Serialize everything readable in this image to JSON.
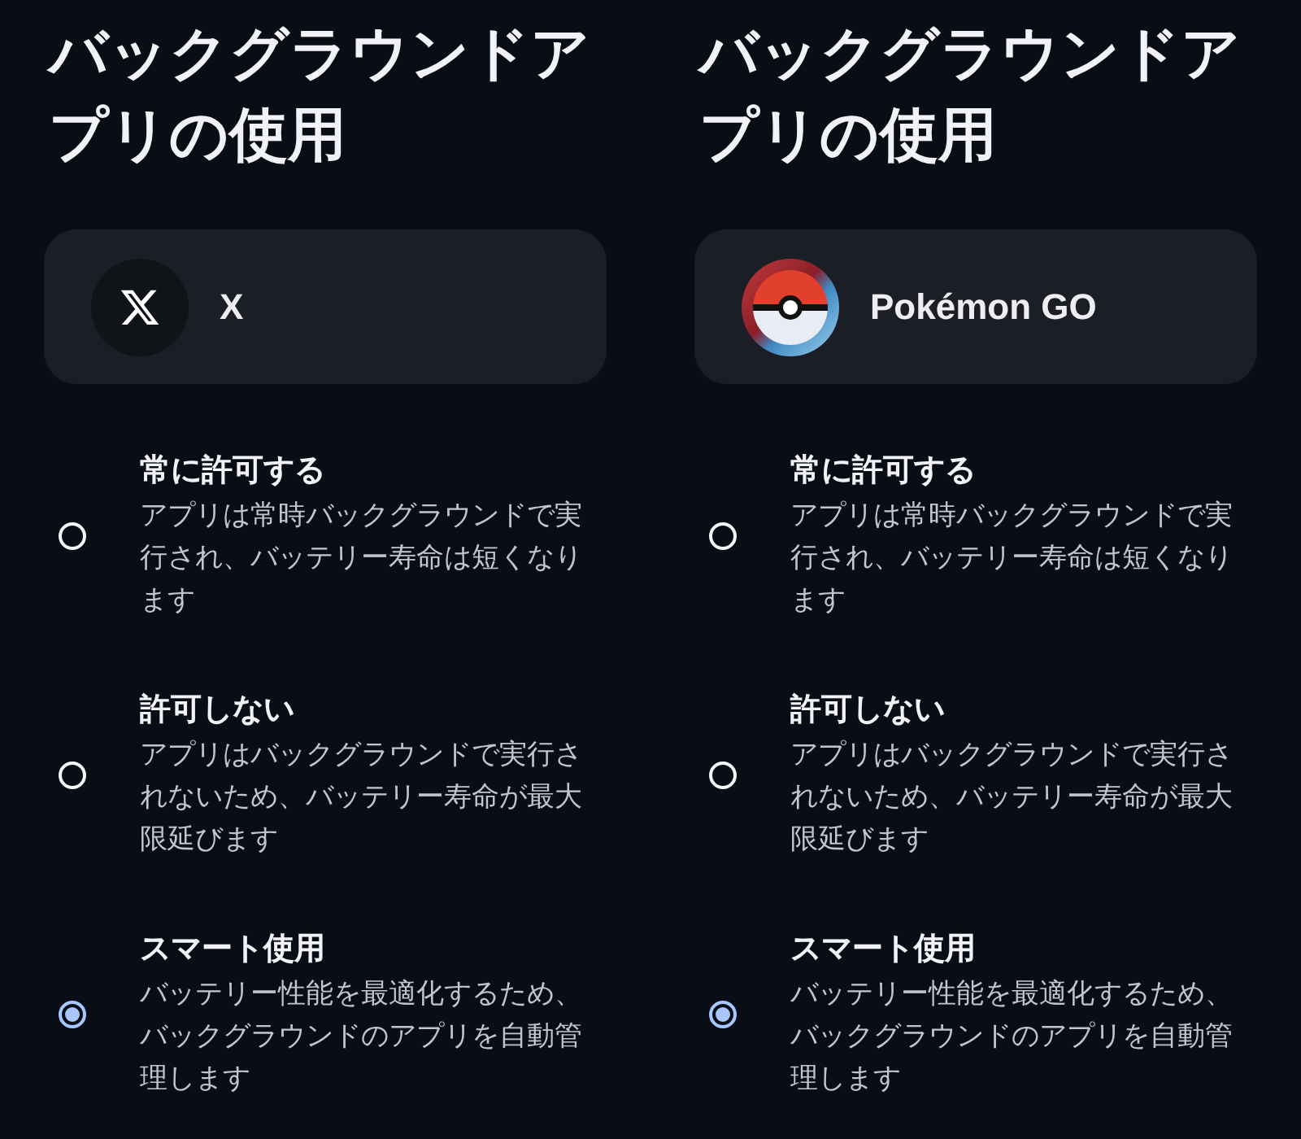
{
  "panels": [
    {
      "title": "バックグラウンドアプリの使用",
      "app": {
        "name": "X",
        "kind": "x"
      },
      "options": [
        {
          "title": "常に許可する",
          "description": "アプリは常時バックグラウンドで実行され、バッテリー寿命は短くなります",
          "selected": false
        },
        {
          "title": "許可しない",
          "description": "アプリはバックグラウンドで実行されないため、バッテリー寿命が最大限延びます",
          "selected": false
        },
        {
          "title": "スマート使用",
          "description": "バッテリー性能を最適化するため、バックグラウンドのアプリを自動管理します",
          "selected": true
        }
      ]
    },
    {
      "title": "バックグラウンドアプリの使用",
      "app": {
        "name": "Pokémon GO",
        "kind": "pokeball"
      },
      "options": [
        {
          "title": "常に許可する",
          "description": "アプリは常時バックグラウンドで実行され、バッテリー寿命は短くなります",
          "selected": false
        },
        {
          "title": "許可しない",
          "description": "アプリはバックグラウンドで実行されないため、バッテリー寿命が最大限延びます",
          "selected": false
        },
        {
          "title": "スマート使用",
          "description": "バッテリー性能を最適化するため、バックグラウンドのアプリを自動管理します",
          "selected": true
        }
      ]
    }
  ]
}
